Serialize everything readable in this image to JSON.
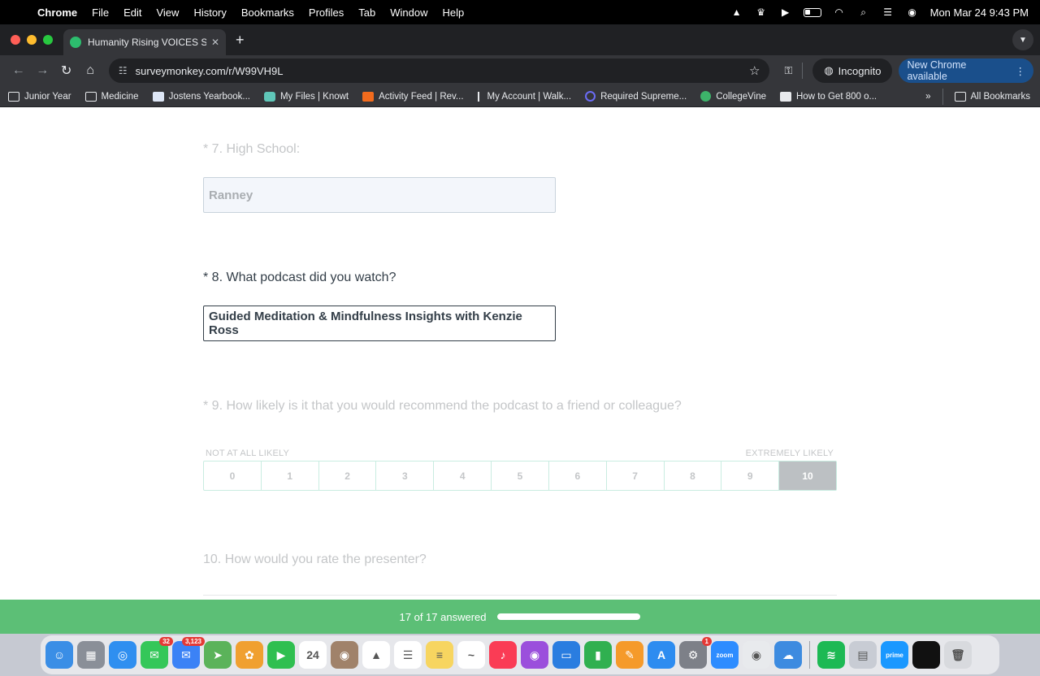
{
  "menubar": {
    "items": [
      "Chrome",
      "File",
      "Edit",
      "View",
      "History",
      "Bookmarks",
      "Profiles",
      "Tab",
      "Window",
      "Help"
    ],
    "datetime": "Mon Mar 24  9:43 PM"
  },
  "tab": {
    "title": "Humanity Rising VOICES Surv",
    "close": "✕",
    "new": "+"
  },
  "toolbar": {
    "url": "surveymonkey.com/r/W99VH9L",
    "incognito": "Incognito",
    "update": "New Chrome available"
  },
  "bookmarks": {
    "items": [
      {
        "label": "Junior Year",
        "icon": "folder"
      },
      {
        "label": "Medicine",
        "icon": "folder"
      },
      {
        "label": "Jostens Yearbook...",
        "icon": "site"
      },
      {
        "label": "My Files | Knowt",
        "icon": "site"
      },
      {
        "label": "Activity Feed | Rev...",
        "icon": "site"
      },
      {
        "label": "My Account | Walk...",
        "icon": "site"
      },
      {
        "label": "Required Supreme...",
        "icon": "site"
      },
      {
        "label": "CollegeVine",
        "icon": "site"
      },
      {
        "label": "How to Get 800 o...",
        "icon": "site"
      }
    ],
    "more": "»",
    "all": "All Bookmarks"
  },
  "survey": {
    "q7": {
      "label": "* 7. High School:",
      "answer": "Ranney"
    },
    "q8": {
      "label": "* 8. What podcast did you watch?",
      "answer": "Guided Meditation & Mindfulness Insights with Kenzie Ross"
    },
    "q9": {
      "label": "* 9. How likely is it that you would recommend the podcast to a friend or colleague?",
      "low_label": "NOT AT ALL LIKELY",
      "high_label": "EXTREMELY LIKELY",
      "options": [
        "0",
        "1",
        "2",
        "3",
        "4",
        "5",
        "6",
        "7",
        "8",
        "9",
        "10"
      ],
      "selected": "10"
    },
    "q10": {
      "label": "10. How would you rate the presenter?"
    }
  },
  "footer": {
    "progress_text": "17 of 17 answered",
    "progress_fraction": 1.0
  },
  "dock": {
    "apps": [
      {
        "name": "finder-icon",
        "color": "#3a8ee6",
        "glyph": "☺"
      },
      {
        "name": "launchpad-icon",
        "color": "#8a8f98",
        "glyph": "▦"
      },
      {
        "name": "safari-icon",
        "color": "#2f8ff0",
        "glyph": "◎"
      },
      {
        "name": "messages-icon",
        "color": "#34c759",
        "glyph": "✉",
        "badge": "32"
      },
      {
        "name": "mail-icon",
        "color": "#3b82f6",
        "glyph": "✉",
        "badge": "3,123"
      },
      {
        "name": "maps-icon",
        "color": "#5bb35a",
        "glyph": "➤"
      },
      {
        "name": "photos-icon",
        "color": "#f0a030",
        "glyph": "✿"
      },
      {
        "name": "facetime-icon",
        "color": "#2fbf50",
        "glyph": "▶"
      },
      {
        "name": "calendar-icon",
        "color": "#ffffff",
        "glyph": "24"
      },
      {
        "name": "contacts-icon",
        "color": "#a0826a",
        "glyph": "◉"
      },
      {
        "name": "drive-icon",
        "color": "#ffffff",
        "glyph": "▲"
      },
      {
        "name": "reminders-icon",
        "color": "#ffffff",
        "glyph": "☰"
      },
      {
        "name": "notes-icon",
        "color": "#f7d560",
        "glyph": "≡"
      },
      {
        "name": "freeform-icon",
        "color": "#ffffff",
        "glyph": "~"
      },
      {
        "name": "music-icon",
        "color": "#fa3c55",
        "glyph": "♪"
      },
      {
        "name": "podcasts-icon",
        "color": "#9b4fdc",
        "glyph": "◉"
      },
      {
        "name": "keynote-icon",
        "color": "#2a7de0",
        "glyph": "▭"
      },
      {
        "name": "numbers-icon",
        "color": "#30b050",
        "glyph": "▮"
      },
      {
        "name": "pages-icon",
        "color": "#f59a2a",
        "glyph": "✎"
      },
      {
        "name": "appstore-icon",
        "color": "#2d8cf0",
        "glyph": "A"
      },
      {
        "name": "settings-icon",
        "color": "#7d8088",
        "glyph": "⚙",
        "badge": "1"
      },
      {
        "name": "zoom-icon",
        "color": "#2d8cff",
        "glyph": "zoom"
      },
      {
        "name": "chrome-icon",
        "color": "#e8eaed",
        "glyph": "◉"
      },
      {
        "name": "weather-icon",
        "color": "#3d8be0",
        "glyph": "☁"
      },
      {
        "name": "spotify-icon",
        "color": "#1db954",
        "glyph": "≋"
      },
      {
        "name": "preview-icon",
        "color": "#c8ccd4",
        "glyph": "▤"
      },
      {
        "name": "primevideo-icon",
        "color": "#1a98ff",
        "glyph": "prime"
      },
      {
        "name": "screenshot-window-icon",
        "color": "#111111",
        "glyph": ""
      },
      {
        "name": "trash-icon",
        "color": "#d8dade",
        "glyph": "🗑"
      }
    ]
  }
}
